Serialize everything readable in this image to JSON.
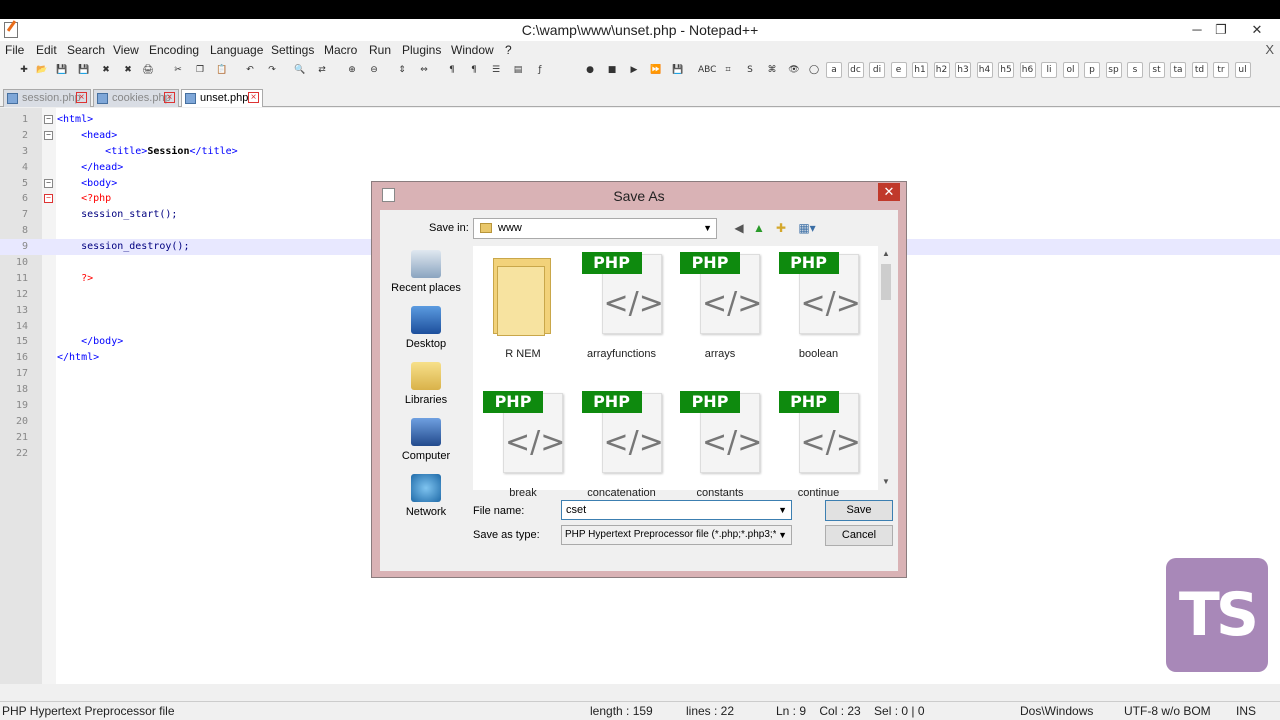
{
  "window": {
    "title": "C:\\wamp\\www\\unset.php - Notepad++",
    "minimize": "─",
    "restore": "❐",
    "close": "✕",
    "doc_close": "X"
  },
  "menu": [
    "File",
    "Edit",
    "Search",
    "View",
    "Encoding",
    "Language",
    "Settings",
    "Macro",
    "Run",
    "Plugins",
    "Window",
    "?"
  ],
  "toolbar_text_buttons": [
    "a",
    "dc",
    "di",
    "e",
    "h1",
    "h2",
    "h3",
    "h4",
    "h5",
    "h6",
    "li",
    "ol",
    "p",
    "sp",
    "s",
    "st",
    "ta",
    "td",
    "tr",
    "ul"
  ],
  "tabs": [
    {
      "label": "session.php",
      "active": false
    },
    {
      "label": "cookies.php",
      "active": false
    },
    {
      "label": "unset.php",
      "active": true
    }
  ],
  "editor": {
    "current_line": 9,
    "lines": [
      {
        "n": "1",
        "html": "<span class='tag'>&lt;html&gt;</span>"
      },
      {
        "n": "2",
        "html": "    <span class='tag'>&lt;head&gt;</span>"
      },
      {
        "n": "3",
        "html": "        <span class='tag'>&lt;title&gt;</span><span class='tagtext'>Session</span><span class='tag'>&lt;/title&gt;</span>"
      },
      {
        "n": "4",
        "html": "    <span class='tag'>&lt;/head&gt;</span>"
      },
      {
        "n": "5",
        "html": "    <span class='tag'>&lt;body&gt;</span>"
      },
      {
        "n": "6",
        "html": "    <span class='php'>&lt;?php</span>"
      },
      {
        "n": "7",
        "html": "    <span class='fn'>session_start();</span>"
      },
      {
        "n": "8",
        "html": ""
      },
      {
        "n": "9",
        "html": "    <span class='fn'>session_destroy();</span>"
      },
      {
        "n": "10",
        "html": ""
      },
      {
        "n": "11",
        "html": "    <span class='php'>?&gt;</span>"
      },
      {
        "n": "12",
        "html": ""
      },
      {
        "n": "13",
        "html": ""
      },
      {
        "n": "14",
        "html": ""
      },
      {
        "n": "15",
        "html": "    <span class='tag'>&lt;/body&gt;</span>"
      },
      {
        "n": "16",
        "html": "<span class='tag'>&lt;/html&gt;</span>"
      },
      {
        "n": "17",
        "html": ""
      },
      {
        "n": "18",
        "html": ""
      },
      {
        "n": "19",
        "html": ""
      },
      {
        "n": "20",
        "html": ""
      },
      {
        "n": "21",
        "html": ""
      },
      {
        "n": "22",
        "html": ""
      }
    ]
  },
  "status": {
    "file_type": "PHP Hypertext Preprocessor file",
    "length": "length : 159",
    "lines": "lines : 22",
    "position": "Ln : 9    Col : 23    Sel : 0 | 0",
    "eol": "Dos\\Windows",
    "encoding": "UTF-8 w/o BOM",
    "mode": "INS"
  },
  "dialog": {
    "title": "Save As",
    "close": "✕",
    "save_in_label": "Save in:",
    "save_in_value": "www",
    "places": [
      "Recent places",
      "Desktop",
      "Libraries",
      "Computer",
      "Network"
    ],
    "files": [
      {
        "name": "R NEM",
        "kind": "folder"
      },
      {
        "name": "arrayfunctions",
        "kind": "php"
      },
      {
        "name": "arrays",
        "kind": "php"
      },
      {
        "name": "boolean",
        "kind": "php"
      },
      {
        "name": "break",
        "kind": "php"
      },
      {
        "name": "concatenation",
        "kind": "php"
      },
      {
        "name": "constants",
        "kind": "php"
      },
      {
        "name": "continue",
        "kind": "php"
      }
    ],
    "php_badge": "PHP",
    "php_glyph": "</>",
    "file_name_label": "File name:",
    "file_name_value": "cset",
    "save_as_type_label": "Save as type:",
    "save_as_type_value": "PHP Hypertext Preprocessor file (*.php;*.php3;*",
    "save_button": "Save",
    "cancel_button": "Cancel"
  },
  "logo_text": "TS",
  "colors": {
    "php_green": "#0e8a0e",
    "dialog_frame": "#d9b2b5",
    "dialog_close": "#c0392b",
    "logo_bg": "#a888b8"
  }
}
